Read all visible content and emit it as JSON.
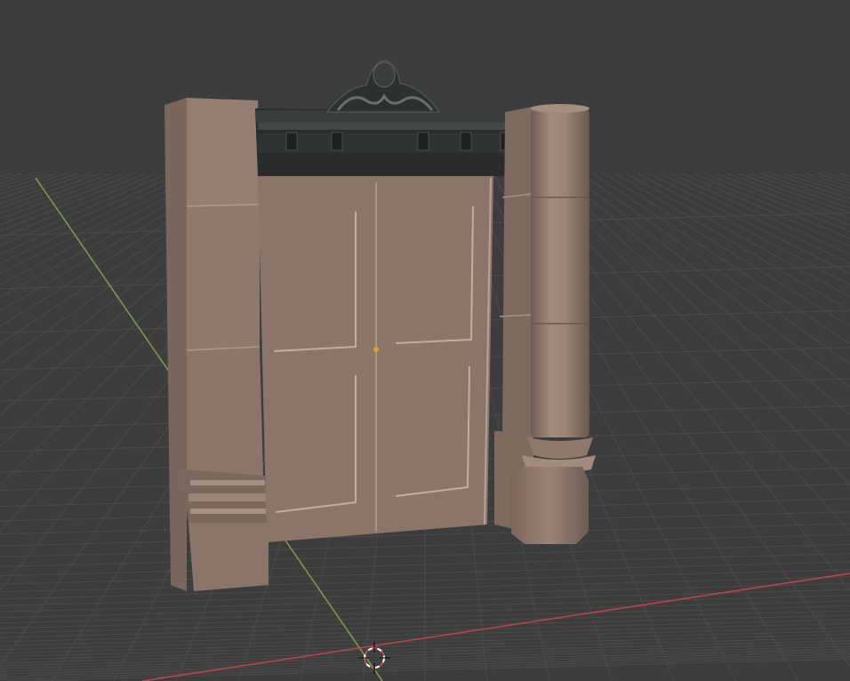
{
  "viewport": {
    "mode": "3d-viewport",
    "shading": "solid",
    "background_color": "#3d3d3d",
    "grid_line_color": "#4a4a4a",
    "x_axis_color": "#c0454f",
    "y_axis_color": "#7ea23c"
  },
  "scene": {
    "objects": [
      {
        "name": "stone-wall-left",
        "material_color": "#8f7a6d"
      },
      {
        "name": "double-door",
        "material_color": "#8a7568"
      },
      {
        "name": "cornice-pediment",
        "material_color": "#2a2c2c"
      },
      {
        "name": "column-right",
        "material_color": "#927d70"
      }
    ],
    "origin_marker_color": "#e6a020",
    "cursor_3d": {
      "icon": "crosshair-icon",
      "ring_colors": [
        "#d44a4a",
        "#ffffff"
      ]
    }
  }
}
